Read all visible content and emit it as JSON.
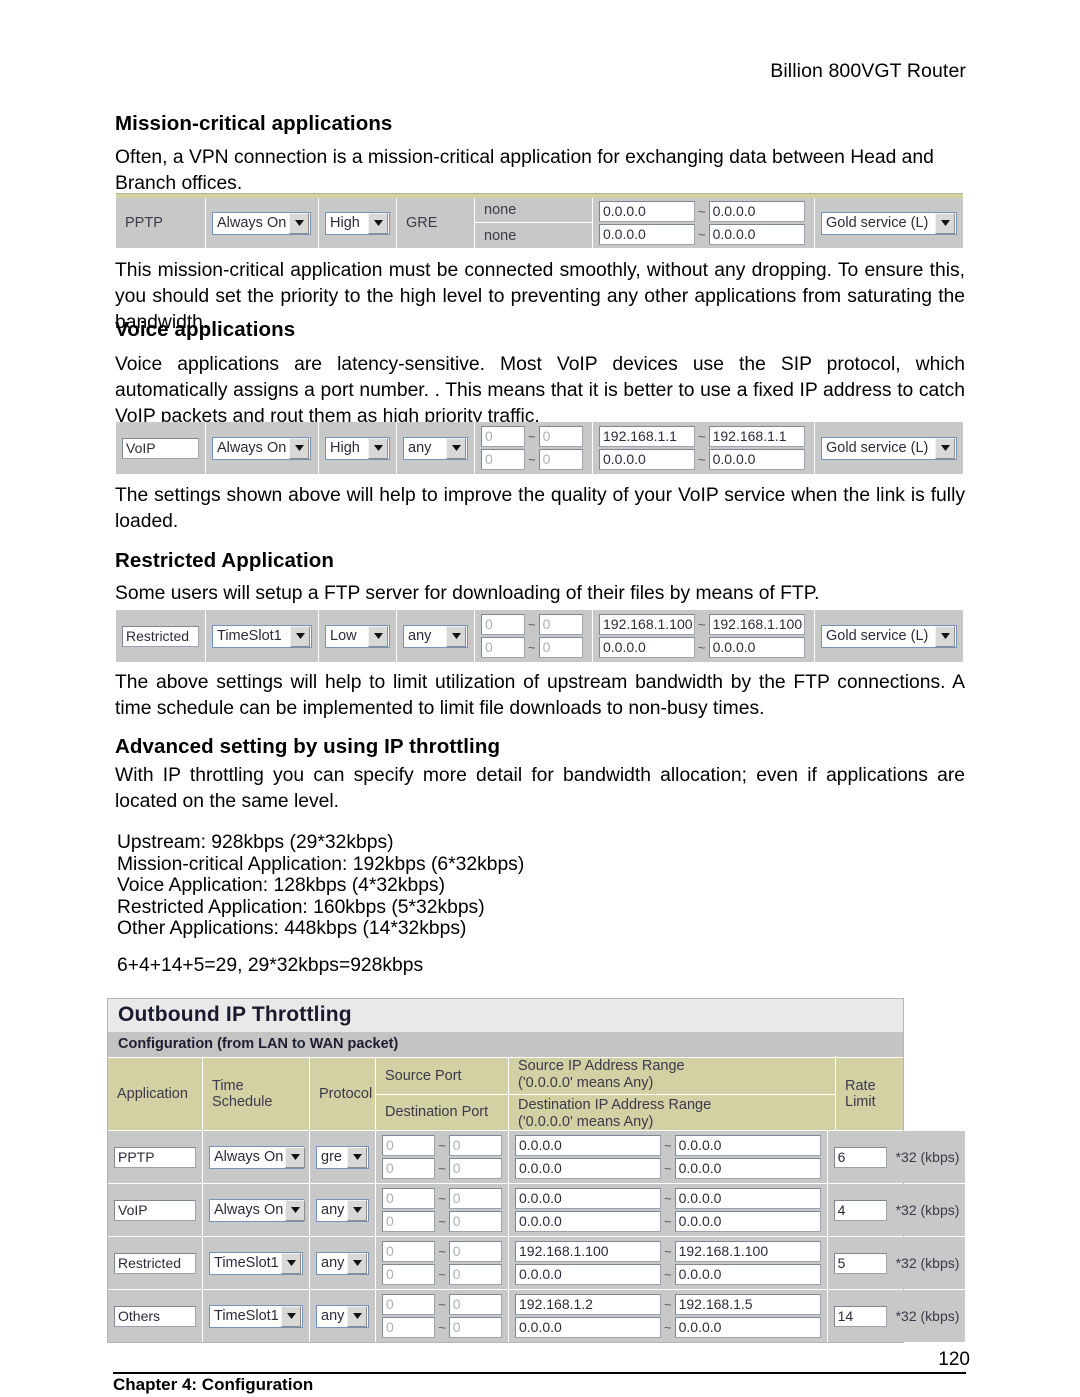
{
  "header": {
    "product": "Billion 800VGT Router"
  },
  "sections": [
    {
      "heading": "Mission-critical applications",
      "body": "Often, a VPN connection is a mission-critical application for exchanging data between Head and Branch offices.",
      "after": "This mission-critical application must be connected smoothly, without any dropping. To ensure this, you should set the priority to the high level to preventing any other applications from saturating the bandwidth."
    },
    {
      "heading": "Voice applications",
      "body": "Voice applications are latency-sensitive. Most VoIP devices use the SIP protocol, which automatically assigns a port number. . This means that it is better to use a fixed IP address to catch VoIP packets and rout them as high priority traffic.",
      "after": "The settings shown above will help to improve the quality of your VoIP service when the link is fully loaded."
    },
    {
      "heading": "Restricted Application",
      "body": "Some users will setup a FTP server for downloading of their files by means of FTP.",
      "after": "The above settings will help to limit utilization of upstream bandwidth by the FTP connections. A time schedule can be implemented to limit file downloads to non-busy times."
    },
    {
      "heading": "Advanced setting by using IP throttling",
      "body": "With IP throttling you can specify more detail for bandwidth allocation; even if applications are located on the same level.",
      "after": ""
    }
  ],
  "bandwidth_list": "Upstream: 928kbps (29*32kbps)\nMission-critical Application: 192kbps (6*32kbps)\nVoice Application: 128kbps (4*32kbps)\nRestricted Application: 160kbps (5*32kbps)\nOther Applications: 448kbps (14*32kbps)",
  "bandwidth_math": "6+4+14+5=29, 29*32kbps=928kbps",
  "qos_rows": {
    "mission_critical": {
      "application": "PPTP",
      "time_schedule": "Always On",
      "priority": "High",
      "protocol": "GRE",
      "source_port": "none",
      "destination_port": "none",
      "source_ip_from": "0.0.0.0",
      "source_ip_to": "0.0.0.0",
      "dest_ip_from": "0.0.0.0",
      "dest_ip_to": "0.0.0.0",
      "rate": "Gold service (L)",
      "tilde": "~"
    },
    "voice": {
      "application": "VoIP",
      "time_schedule": "Always On",
      "priority": "High",
      "protocol": "any",
      "source_port_from": "0",
      "source_port_to": "0",
      "destination_port_from": "0",
      "destination_port_to": "0",
      "source_ip_from": "192.168.1.1",
      "source_ip_to": "192.168.1.1",
      "dest_ip_from": "0.0.0.0",
      "dest_ip_to": "0.0.0.0",
      "rate": "Gold service (L)",
      "tilde": "~"
    },
    "restricted": {
      "application": "Restricted",
      "time_schedule": "TimeSlot1",
      "priority": "Low",
      "protocol": "any",
      "source_port_from": "0",
      "source_port_to": "0",
      "destination_port_from": "0",
      "destination_port_to": "0",
      "source_ip_from": "192.168.1.100",
      "source_ip_to": "192.168.1.100",
      "dest_ip_from": "0.0.0.0",
      "dest_ip_to": "0.0.0.0",
      "rate": "Gold service (L)",
      "tilde": "~"
    }
  },
  "throttling_panel": {
    "title": "Outbound IP Throttling",
    "subtitle": "Configuration (from LAN to WAN packet)",
    "headers": {
      "application": "Application",
      "time_schedule": "Time Schedule",
      "protocol": "Protocol",
      "source_port": "Source Port",
      "destination_port": "Destination Port",
      "source_ip_range_l1": "Source IP Address Range",
      "source_ip_range_l2": "('0.0.0.0' means Any)",
      "dest_ip_range_l1": "Destination IP Address Range",
      "dest_ip_range_l2": "('0.0.0.0' means Any)",
      "rate_limit": "Rate Limit"
    },
    "rate_suffix": "*32 (kbps)",
    "tilde": "~",
    "rows": [
      {
        "application": "PPTP",
        "time_schedule": "Always On",
        "protocol": "gre",
        "source_port_from": "0",
        "source_port_to": "0",
        "destination_port_from": "0",
        "destination_port_to": "0",
        "source_ip_from": "0.0.0.0",
        "source_ip_to": "0.0.0.0",
        "dest_ip_from": "0.0.0.0",
        "dest_ip_to": "0.0.0.0",
        "rate_limit": "6"
      },
      {
        "application": "VoIP",
        "time_schedule": "Always On",
        "protocol": "any",
        "source_port_from": "0",
        "source_port_to": "0",
        "destination_port_from": "0",
        "destination_port_to": "0",
        "source_ip_from": "0.0.0.0",
        "source_ip_to": "0.0.0.0",
        "dest_ip_from": "0.0.0.0",
        "dest_ip_to": "0.0.0.0",
        "rate_limit": "4"
      },
      {
        "application": "Restricted",
        "time_schedule": "TimeSlot1",
        "protocol": "any",
        "source_port_from": "0",
        "source_port_to": "0",
        "destination_port_from": "0",
        "destination_port_to": "0",
        "source_ip_from": "192.168.1.100",
        "source_ip_to": "192.168.1.100",
        "dest_ip_from": "0.0.0.0",
        "dest_ip_to": "0.0.0.0",
        "rate_limit": "5"
      },
      {
        "application": "Others",
        "time_schedule": "TimeSlot1",
        "protocol": "any",
        "source_port_from": "0",
        "source_port_to": "0",
        "destination_port_from": "0",
        "destination_port_to": "0",
        "source_ip_from": "192.168.1.2",
        "source_ip_to": "192.168.1.5",
        "dest_ip_from": "0.0.0.0",
        "dest_ip_to": "0.0.0.0",
        "rate_limit": "14"
      }
    ]
  },
  "footer": {
    "page_number": "120",
    "chapter": "Chapter 4: Configuration"
  },
  "colors": {
    "header_khaki": "#d3d0a3",
    "panel_title_bg": "#e9e9e9",
    "panel_sub_bg": "#c4c4c4",
    "row_bg": "#c8c8c8",
    "input_border": "#7d8894",
    "select_border": "#7593b8"
  }
}
